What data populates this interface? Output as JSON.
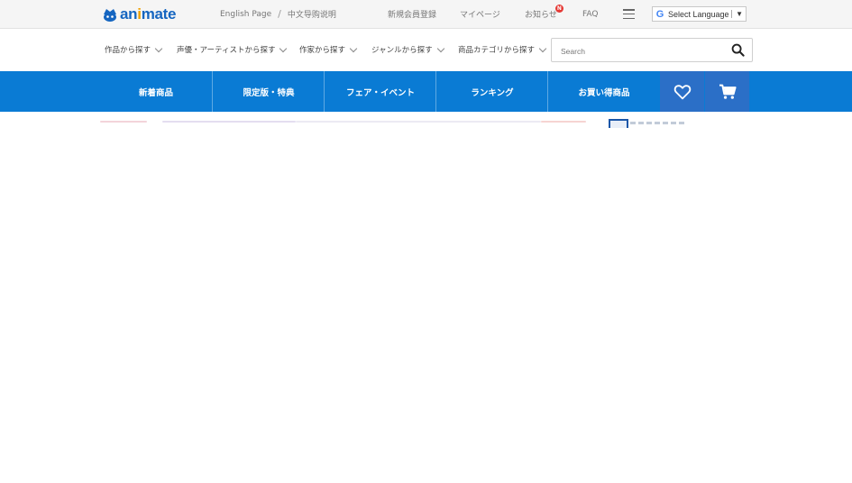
{
  "header": {
    "logo": {
      "prefix": "an",
      "highlight": "i",
      "suffix": "mate"
    },
    "links": {
      "english": "English Page",
      "separator": "/",
      "chinese": "中文导购说明",
      "register": "新規会員登録",
      "mypage": "マイページ",
      "notice": "お知らせ",
      "notice_badge": "N",
      "faq": "FAQ"
    },
    "language_select": "Select Language",
    "language_arrow": "▼"
  },
  "categories": [
    "作品から探す",
    "声優・アーティストから探す",
    "作家から探す",
    "ジャンルから探す",
    "商品カテゴリから探す"
  ],
  "search": {
    "placeholder": "Search",
    "value": ""
  },
  "main_nav": [
    "新着商品",
    "限定版・特典",
    "フェア・イベント",
    "ランキング",
    "お買い得商品"
  ],
  "colors": {
    "nav_blue": "#0a7bd4",
    "nav_button_blue": "#2b6fc7",
    "logo_blue": "#1565c0",
    "logo_accent": "#f0a000",
    "badge_red": "#e53935"
  },
  "icons": {
    "favorites": "heart-icon",
    "cart": "cart-icon",
    "search": "search-icon",
    "menu": "hamburger-icon",
    "google": "google-icon"
  }
}
